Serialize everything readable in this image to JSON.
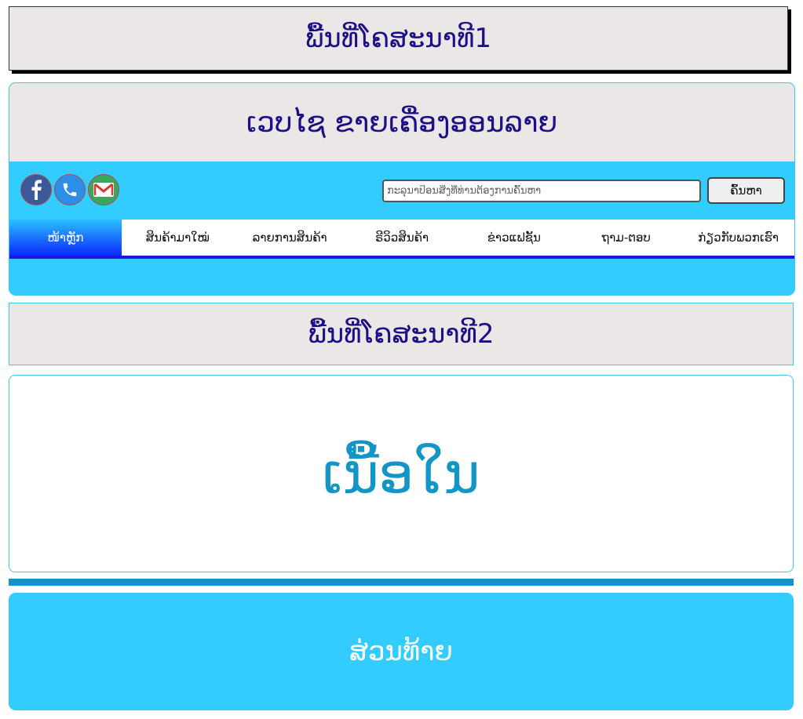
{
  "ad_space_1": {
    "label": "ພື້ນທີ່ໂຄສະນາທີ1"
  },
  "header": {
    "title": "ເວບໄຊ ຂາຍເຄື່ອງອອນລາຍ"
  },
  "social": [
    {
      "name": "facebook",
      "icon": "facebook-icon",
      "color": "#3b5998"
    },
    {
      "name": "phone",
      "icon": "phone-icon",
      "color": "#2d8ee8"
    },
    {
      "name": "email",
      "icon": "mail-icon",
      "color": "#3aa75e"
    }
  ],
  "search": {
    "placeholder": "ກະລຸນາປ້ອນສິ່ງທີ່ທ່ານຕ້ອງການຄົ້ນຫາ",
    "button_label": "ຄົ້ນຫາ"
  },
  "nav": {
    "items": [
      {
        "label": "ໜ້າຫຼັກ",
        "active": true
      },
      {
        "label": "ສິນຄ້າມາໃໝ່",
        "active": false
      },
      {
        "label": "ລາຍການສິນຄ້າ",
        "active": false
      },
      {
        "label": "ຣີວິວສິນຄ້າ",
        "active": false
      },
      {
        "label": "ຂ່າວແຟຊັ້ນ",
        "active": false
      },
      {
        "label": "ຖາມ-ຕອບ",
        "active": false
      },
      {
        "label": "ກ່ຽວກັບພວກເຮົາ",
        "active": false
      }
    ]
  },
  "ad_space_2": {
    "label": "ພື້ນທີ່ໂຄສະນາທີ2"
  },
  "content": {
    "label": "ເນື້ອໃນ"
  },
  "footer": {
    "label": "ສ່ວນທ້າຍ"
  },
  "colors": {
    "header_bg": "#33ccff",
    "ad_bg": "#ebe7e7",
    "ad_text": "#1d0f85",
    "content_text": "#1396c6",
    "nav_underline": "#1a14e8"
  }
}
